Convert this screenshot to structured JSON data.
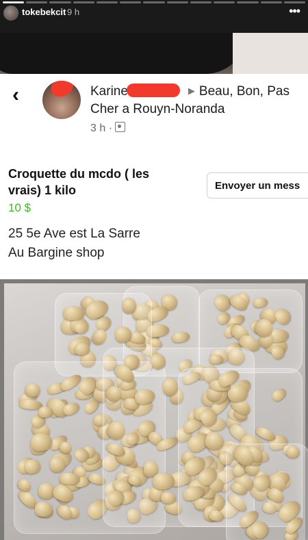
{
  "story": {
    "username": "tokebekcit",
    "time": "9 h",
    "progress_segments": 13,
    "progress_done": 1,
    "more_icon": "more-dots-icon"
  },
  "post": {
    "author_first_name": "Karine",
    "group_line": "Beau, Bon, Pas Cher a Rouyn-Noranda",
    "time": "3 h ·",
    "back_icon": "back-chevron-icon",
    "group_icon": "group-icon"
  },
  "listing": {
    "title": "Croquette du mcdo ( les vrais) 1 kilo",
    "price": "10 $",
    "address_line1": "25 5e Ave est La Sarre",
    "address_line2": "Au Bargine shop",
    "send_button_label": "Envoyer un mess",
    "price_color": "#42b72a"
  }
}
